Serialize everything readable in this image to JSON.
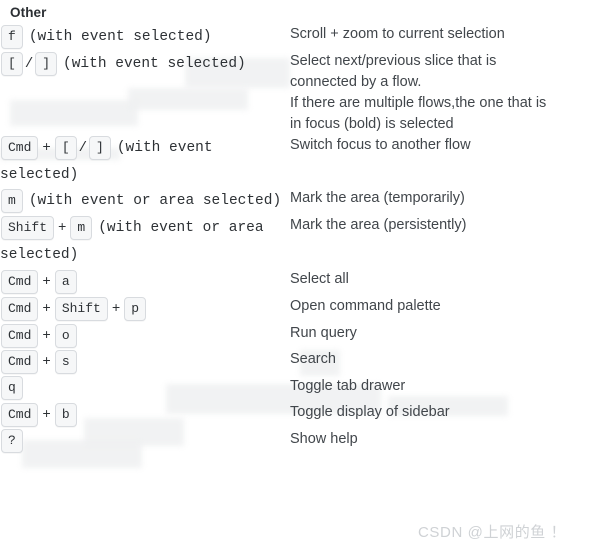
{
  "section": {
    "title": "Other"
  },
  "watermark": {
    "text": "CSDN @上网的鱼 ！"
  },
  "rows": [
    {
      "id": "zoom-to-selection",
      "keys": [
        {
          "type": "key",
          "label": "f"
        },
        {
          "type": "note",
          "label": "(with event selected)"
        }
      ],
      "description_lines": [
        "Scroll + zoom to current selection"
      ]
    },
    {
      "id": "select-next-prev-slice",
      "keys": [
        {
          "type": "key",
          "label": "["
        },
        {
          "type": "slash",
          "label": "/"
        },
        {
          "type": "key",
          "label": "]"
        },
        {
          "type": "note",
          "label": "(with event selected)"
        }
      ],
      "description_lines": [
        "Select next/previous slice that is",
        "connected by a flow.",
        "If there are multiple flows,the one that is",
        "in focus (bold) is selected"
      ]
    },
    {
      "id": "switch-focus-flow",
      "keys": [
        {
          "type": "key",
          "label": "Cmd"
        },
        {
          "type": "plus",
          "label": "+"
        },
        {
          "type": "key",
          "label": "["
        },
        {
          "type": "slash",
          "label": "/"
        },
        {
          "type": "key",
          "label": "]"
        },
        {
          "type": "note",
          "label": "(with event selected)"
        }
      ],
      "description_lines": [
        "Switch focus to another flow"
      ]
    },
    {
      "id": "mark-area-temporarily",
      "keys": [
        {
          "type": "key",
          "label": "m"
        },
        {
          "type": "note",
          "label": "(with event or area selected)"
        }
      ],
      "description_lines": [
        "Mark the area (temporarily)"
      ]
    },
    {
      "id": "mark-area-persistently",
      "keys": [
        {
          "type": "key",
          "label": "Shift"
        },
        {
          "type": "plus",
          "label": "+"
        },
        {
          "type": "key",
          "label": "m"
        },
        {
          "type": "note",
          "label": "(with event or area selected)"
        }
      ],
      "description_lines": [
        "Mark the area (persistently)"
      ]
    },
    {
      "id": "select-all",
      "keys": [
        {
          "type": "key",
          "label": "Cmd"
        },
        {
          "type": "plus",
          "label": "+"
        },
        {
          "type": "key",
          "label": "a"
        }
      ],
      "description_lines": [
        "Select all"
      ]
    },
    {
      "id": "open-command-palette",
      "keys": [
        {
          "type": "key",
          "label": "Cmd"
        },
        {
          "type": "plus",
          "label": "+"
        },
        {
          "type": "key",
          "label": "Shift"
        },
        {
          "type": "plus",
          "label": "+"
        },
        {
          "type": "key",
          "label": "p"
        }
      ],
      "description_lines": [
        "Open command palette"
      ]
    },
    {
      "id": "run-query",
      "keys": [
        {
          "type": "key",
          "label": "Cmd"
        },
        {
          "type": "plus",
          "label": "+"
        },
        {
          "type": "key",
          "label": "o"
        }
      ],
      "description_lines": [
        "Run query"
      ]
    },
    {
      "id": "search",
      "keys": [
        {
          "type": "key",
          "label": "Cmd"
        },
        {
          "type": "plus",
          "label": "+"
        },
        {
          "type": "key",
          "label": "s"
        }
      ],
      "description_lines": [
        "Search"
      ]
    },
    {
      "id": "toggle-tab-drawer",
      "keys": [
        {
          "type": "key",
          "label": "q"
        }
      ],
      "description_lines": [
        "Toggle tab drawer"
      ]
    },
    {
      "id": "toggle-sidebar",
      "keys": [
        {
          "type": "key",
          "label": "Cmd"
        },
        {
          "type": "plus",
          "label": "+"
        },
        {
          "type": "key",
          "label": "b"
        }
      ],
      "description_lines": [
        "Toggle display of sidebar"
      ]
    },
    {
      "id": "show-help",
      "keys": [
        {
          "type": "key",
          "label": "?"
        }
      ],
      "description_lines": [
        "Show help"
      ]
    }
  ]
}
